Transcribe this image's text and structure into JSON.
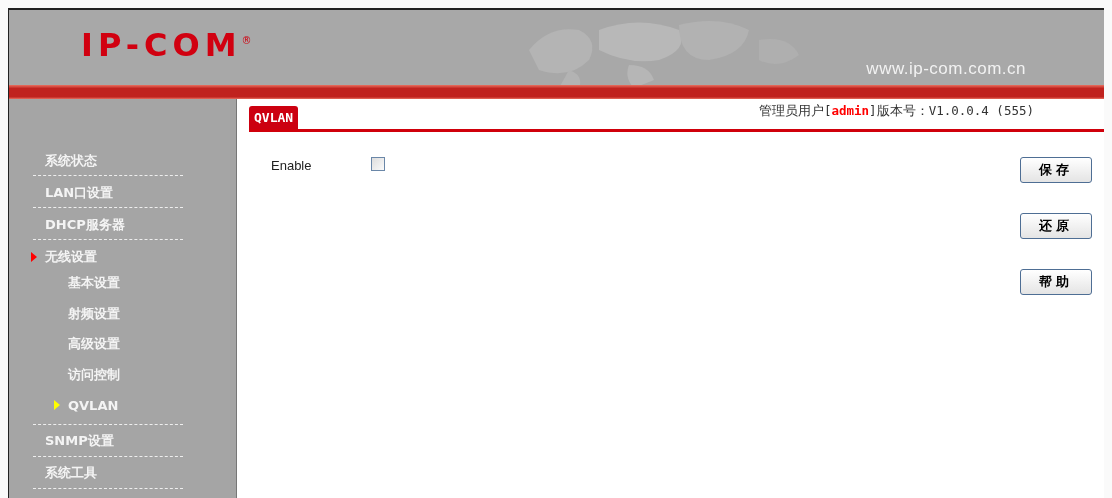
{
  "header": {
    "logo": "IP-COM$^{®}$",
    "url": "www.ip-com.com.cn"
  },
  "sidebar": {
    "items": [
      {
        "label": "系统状态",
        "expanded": false
      },
      {
        "label": "LAN口设置",
        "expanded": false
      },
      {
        "label": "DHCP服务器",
        "expanded": false
      },
      {
        "label": "无线设置",
        "expanded": true,
        "children": [
          {
            "label": "基本设置",
            "selected": false
          },
          {
            "label": "射频设置",
            "selected": false
          },
          {
            "label": "高级设置",
            "selected": false
          },
          {
            "label": "访问控制",
            "selected": false
          },
          {
            "label": "QVLAN",
            "selected": true
          }
        ]
      },
      {
        "label": "SNMP设置",
        "expanded": false
      },
      {
        "label": "系统工具",
        "expanded": false
      }
    ]
  },
  "tabs": [
    {
      "label": "QVLAN",
      "selected": true
    }
  ],
  "user_info": {
    "prefix": "管理员用户[",
    "user": "admin",
    "suffix": "]版本号：V1.0.0.4 (555)"
  },
  "form": {
    "fields": [
      {
        "label": "Enable",
        "checked": false
      }
    ]
  },
  "buttons": [
    "保存",
    "还原",
    "帮助"
  ]
}
